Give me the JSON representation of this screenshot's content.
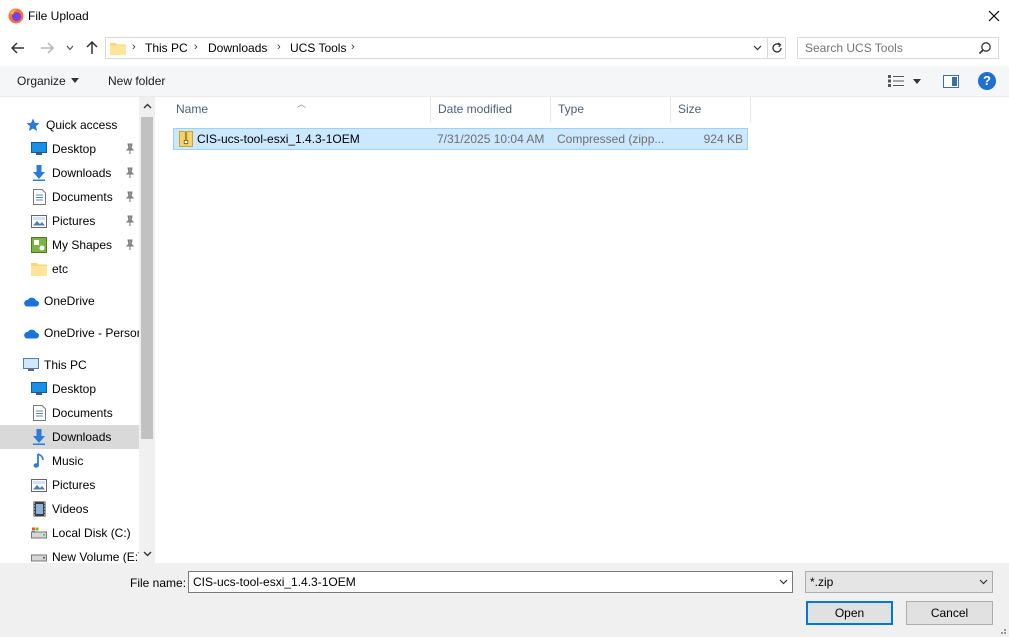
{
  "window": {
    "title": "File Upload",
    "close_symbol": "✕"
  },
  "breadcrumb": [
    "This PC",
    "Downloads",
    "UCS Tools"
  ],
  "search": {
    "placeholder": "Search UCS Tools"
  },
  "toolbar": {
    "organize_label": "Organize",
    "new_folder_label": "New folder",
    "help_label": "?"
  },
  "nav": {
    "quick_access": "Quick access",
    "qa_items": [
      {
        "label": "Desktop",
        "icon": "desktop-icon"
      },
      {
        "label": "Downloads",
        "icon": "download-arrow-icon"
      },
      {
        "label": "Documents",
        "icon": "documents-icon"
      },
      {
        "label": "Pictures",
        "icon": "pictures-icon"
      },
      {
        "label": "My Shapes",
        "icon": "shapes-icon"
      },
      {
        "label": "etc",
        "icon": "folder-icon"
      }
    ],
    "onedrive": "OneDrive",
    "onedrive_personal": "OneDrive - Personal",
    "this_pc": "This PC",
    "pc_items": [
      {
        "label": "Desktop",
        "icon": "desktop-icon"
      },
      {
        "label": "Documents",
        "icon": "documents-icon"
      },
      {
        "label": "Downloads",
        "icon": "download-arrow-icon",
        "selected": true
      },
      {
        "label": "Music",
        "icon": "music-icon"
      },
      {
        "label": "Pictures",
        "icon": "pictures-icon"
      },
      {
        "label": "Videos",
        "icon": "videos-icon"
      },
      {
        "label": "Local Disk (C:)",
        "icon": "local-disk-icon"
      },
      {
        "label": "New Volume (E:)",
        "icon": "drive-icon"
      }
    ]
  },
  "columns": {
    "name": "Name",
    "date_modified": "Date modified",
    "type": "Type",
    "size": "Size"
  },
  "files": [
    {
      "name": "CIS-ucs-tool-esxi_1.4.3-1OEM",
      "date_modified": "7/31/2025 10:04 AM",
      "type": "Compressed (zipp...",
      "size": "924 KB",
      "selected": true
    }
  ],
  "bottom": {
    "file_name_label": "File name:",
    "file_name_value": "CIS-ucs-tool-esxi_1.4.3-1OEM",
    "file_type_value": "*.zip",
    "open_label": "Open",
    "cancel_label": "Cancel"
  },
  "colors": {
    "selection_bg": "#cce8ff",
    "selection_border": "#99d1ff",
    "accent": "#0078d7",
    "nav_selected": "#d9d9d9"
  }
}
